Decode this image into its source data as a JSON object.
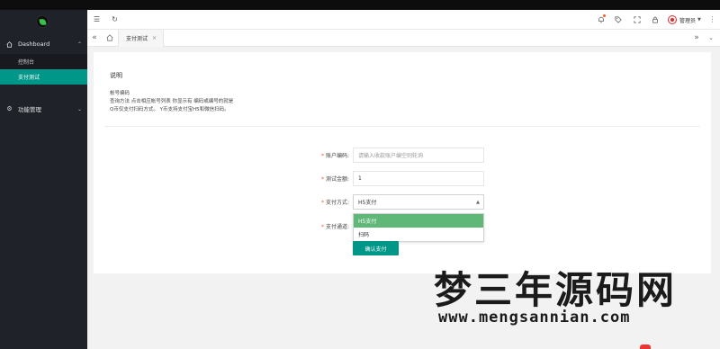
{
  "sidebar": {
    "groups": [
      {
        "label": "Dashboard",
        "icon": "home-icon",
        "expanded": true,
        "items": [
          {
            "label": "控制台",
            "active": false
          },
          {
            "label": "支付测试",
            "active": true
          }
        ]
      },
      {
        "label": "功能管理",
        "icon": "gear-icon",
        "expanded": false
      }
    ]
  },
  "header": {
    "username": "管理员",
    "icons": [
      "menu-icon",
      "refresh-icon",
      "bell-icon",
      "tag-icon",
      "fullscreen-icon",
      "lock-icon",
      "more-icon"
    ]
  },
  "tabs": {
    "items": [
      {
        "label": "支付测试",
        "active": true
      }
    ]
  },
  "description": {
    "title": "说明",
    "lines": [
      "帐号编码",
      "查询方法 点击相应帐号列表 你显示有 编码或编号的就是",
      "Q币仅支付扫码方式。 Y币支持支付宝H5和微信扫码。"
    ]
  },
  "form": {
    "account": {
      "label": "账户编码:",
      "placeholder": "请输入收款账户编空则轮询"
    },
    "amount": {
      "label": "测试金额:",
      "value": "1"
    },
    "method": {
      "label": "支付方式:",
      "value": "H5支付",
      "options": [
        "H5支付",
        "扫码"
      ]
    },
    "channel": {
      "label": "支付通道:"
    },
    "submit_label": "确认支付"
  },
  "colors": {
    "accent": "#009688",
    "selected_option": "#5fb878",
    "sidebar": "#20222a",
    "required": "#ff5722"
  },
  "watermark": {
    "text": "梦三年源码网",
    "url": "www.mengsannian.com"
  }
}
